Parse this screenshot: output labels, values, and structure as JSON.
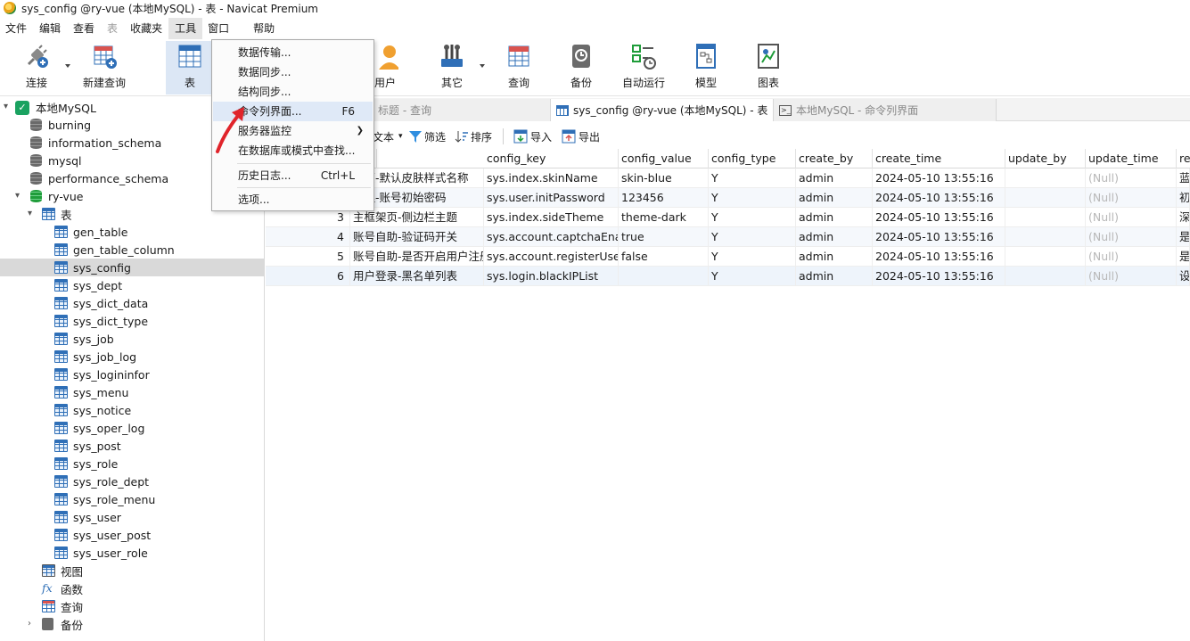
{
  "window": {
    "title": "sys_config @ry-vue (本地MySQL) - 表 - Navicat Premium"
  },
  "menubar": {
    "items": [
      "文件",
      "编辑",
      "查看",
      "表",
      "收藏夹",
      "工具",
      "窗口",
      "帮助"
    ]
  },
  "toolbar": {
    "connect": "连接",
    "new_query": "新建查询",
    "table": "表",
    "user": "用户",
    "other": "其它",
    "query": "查询",
    "backup": "备份",
    "auto_run": "自动运行",
    "model": "模型",
    "chart": "图表"
  },
  "tools_menu": {
    "items": [
      {
        "label": "数据传输...",
        "shortcut": ""
      },
      {
        "label": "数据同步...",
        "shortcut": ""
      },
      {
        "label": "结构同步...",
        "shortcut": ""
      },
      {
        "label": "命令列界面...",
        "shortcut": "F6"
      },
      {
        "label": "服务器监控",
        "shortcut": ""
      },
      {
        "label": "在数据库或模式中查找...",
        "shortcut": ""
      },
      {
        "label": "历史日志...",
        "shortcut": "Ctrl+L"
      },
      {
        "label": "选项...",
        "shortcut": ""
      }
    ]
  },
  "tree": {
    "connection": "本地MySQL",
    "databases": [
      "burning",
      "information_schema",
      "mysql",
      "performance_schema",
      "ry-vue"
    ],
    "tables_group": "表",
    "tables": [
      "gen_table",
      "gen_table_column",
      "sys_config",
      "sys_dept",
      "sys_dict_data",
      "sys_dict_type",
      "sys_job",
      "sys_job_log",
      "sys_logininfor",
      "sys_menu",
      "sys_notice",
      "sys_oper_log",
      "sys_post",
      "sys_role",
      "sys_role_dept",
      "sys_role_menu",
      "sys_user",
      "sys_user_post",
      "sys_user_role"
    ],
    "views": "视图",
    "functions": "函数",
    "queries": "查询",
    "backups": "备份"
  },
  "tabs": [
    {
      "label": "标题 - 查询"
    },
    {
      "label": "sys_config @ry-vue (本地MySQL) - 表"
    },
    {
      "label": "本地MySQL - 命令列界面"
    }
  ],
  "subtoolbar": {
    "text": "文本",
    "filter": "筛选",
    "sort": "排序",
    "import": "导入",
    "export": "导出"
  },
  "grid": {
    "columns": [
      "config_name",
      "config_key",
      "config_value",
      "config_type",
      "create_by",
      "create_time",
      "update_by",
      "update_time",
      "re"
    ],
    "header_first": "ig_name",
    "rows": [
      {
        "id": "",
        "name": "架页-默认皮肤样式名称",
        "key": "sys.index.skinName",
        "value": "skin-blue",
        "type": "Y",
        "by": "admin",
        "time": "2024-05-10 13:55:16",
        "uby": "",
        "utime": "(Null)",
        "re": "蓝"
      },
      {
        "id": "",
        "name": "管理-账号初始密码",
        "key": "sys.user.initPassword",
        "value": "123456",
        "type": "Y",
        "by": "admin",
        "time": "2024-05-10 13:55:16",
        "uby": "",
        "utime": "(Null)",
        "re": "初"
      },
      {
        "id": "3",
        "name": "主框架页-侧边栏主题",
        "key": "sys.index.sideTheme",
        "value": "theme-dark",
        "type": "Y",
        "by": "admin",
        "time": "2024-05-10 13:55:16",
        "uby": "",
        "utime": "(Null)",
        "re": "深"
      },
      {
        "id": "4",
        "name": "账号自助-验证码开关",
        "key": "sys.account.captchaEnabled",
        "value": "true",
        "type": "Y",
        "by": "admin",
        "time": "2024-05-10 13:55:16",
        "uby": "",
        "utime": "(Null)",
        "re": "是"
      },
      {
        "id": "5",
        "name": "账号自助-是否开启用户注册",
        "key": "sys.account.registerUser",
        "value": "false",
        "type": "Y",
        "by": "admin",
        "time": "2024-05-10 13:55:16",
        "uby": "",
        "utime": "(Null)",
        "re": "是"
      },
      {
        "id": "6",
        "name": "用户登录-黑名单列表",
        "key": "sys.login.blackIPList",
        "value": "",
        "type": "Y",
        "by": "admin",
        "time": "2024-05-10 13:55:16",
        "uby": "",
        "utime": "(Null)",
        "re": "设"
      }
    ]
  },
  "colors": {
    "accent": "#2f6fb7",
    "selected_tab_bg": "#dce7f5",
    "menu_hover": "#dfe9f7",
    "null_text": "#b8b8b8",
    "arrow": "#e0242b"
  }
}
